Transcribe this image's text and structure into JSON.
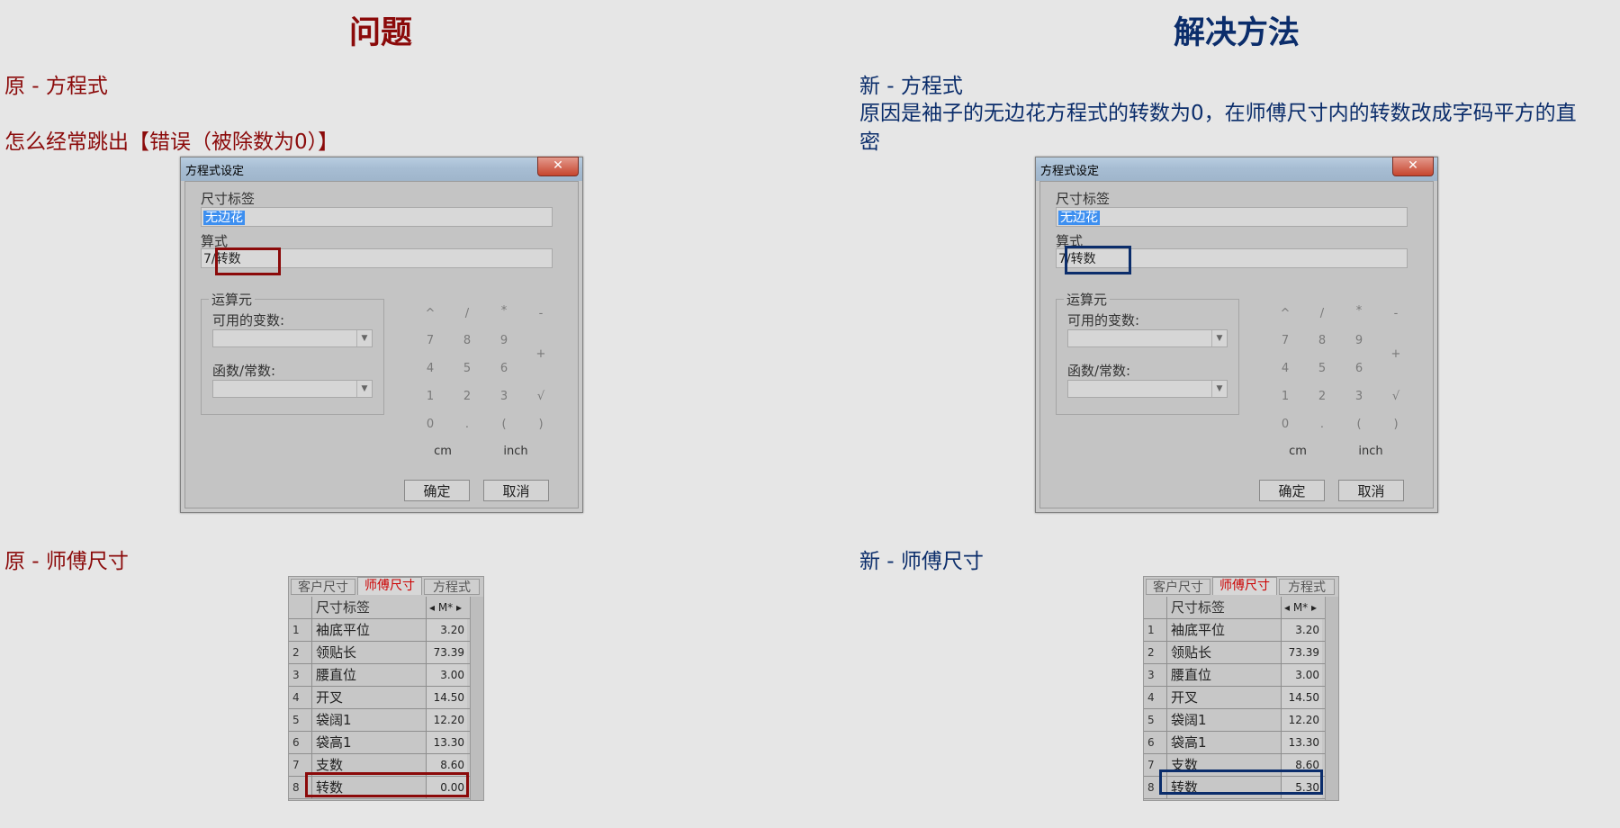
{
  "left": {
    "heading": "问题",
    "sub1": "原 - 方程式",
    "sub2": "怎么经常跳出【错误（被除数为0）】",
    "sub3": "原 - 师傅尺寸",
    "highlight_color": "#8b0a0a"
  },
  "right": {
    "heading": "解决方法",
    "sub1": "新 - 方程式",
    "explain_line1": "原因是袖子的无边花方程式的转数为0，在师傅尺寸内的转数改成字码平方的直",
    "explain_line2": "密",
    "sub3": "新 - 师傅尺寸",
    "highlight_color": "#0b2d6b"
  },
  "dialog": {
    "title": "方程式设定",
    "close_glyph": "✕",
    "size_label": "尺寸标签",
    "size_value": "无边花",
    "formula_label": "算式",
    "formula_prefix": "7/",
    "formula_var": "转数",
    "operands_label": "运算元",
    "vars_label": "可用的变数:",
    "funcs_label": "函数/常数:",
    "keys": [
      "^",
      "/",
      "*",
      "-",
      "7",
      "8",
      "9",
      "+",
      "4",
      "5",
      "6",
      "1",
      "2",
      "3",
      "√",
      "0",
      ".",
      "(",
      ")"
    ],
    "unit_cm": "cm",
    "unit_inch": "inch",
    "ok": "确定",
    "cancel": "取消"
  },
  "table": {
    "tabs": [
      "客户尺寸",
      "师傅尺寸",
      "方程式"
    ],
    "col_label": "尺寸标签",
    "col_unit": "◂ M* ▸",
    "rows": [
      {
        "no": "1",
        "name": "袖底平位",
        "value": "3.20"
      },
      {
        "no": "2",
        "name": "领贴长",
        "value": "73.39"
      },
      {
        "no": "3",
        "name": "腰直位",
        "value": "3.00"
      },
      {
        "no": "4",
        "name": "开叉",
        "value": "14.50"
      },
      {
        "no": "5",
        "name": "袋阔1",
        "value": "12.20"
      },
      {
        "no": "6",
        "name": "袋高1",
        "value": "13.30"
      },
      {
        "no": "7",
        "name": "支数",
        "value": "8.60"
      },
      {
        "no": "8",
        "name": "转数",
        "value": "0.00"
      }
    ],
    "new_last_value": "5.30"
  }
}
